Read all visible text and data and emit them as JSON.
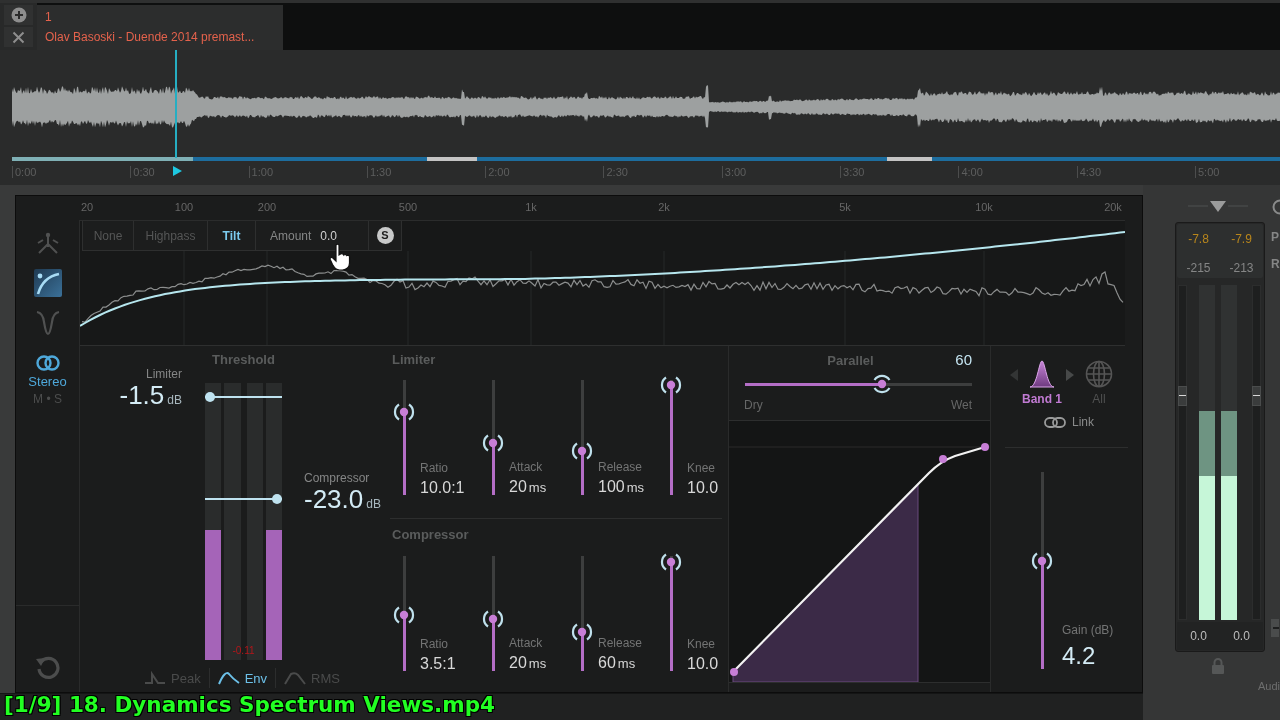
{
  "session_tab": {
    "number": "1",
    "title": "Olav Basoski - Duende 2014 premast..."
  },
  "timeline": {
    "labels": [
      "0:00",
      "0:30",
      "1:00",
      "1:30",
      "2:00",
      "2:30",
      "3:00",
      "3:30",
      "4:00",
      "4:30",
      "5:00"
    ]
  },
  "spectrum": {
    "frequency_labels": [
      "20",
      "100",
      "200",
      "500",
      "1k",
      "2k",
      "5k",
      "10k",
      "20k"
    ],
    "view_tools": [
      {
        "kind": "fan",
        "selected": false
      },
      {
        "kind": "curve",
        "selected": true
      },
      {
        "kind": "notch",
        "selected": false
      }
    ],
    "filter_modes": [
      {
        "label": "None",
        "selected": false
      },
      {
        "label": "Highpass",
        "selected": false
      },
      {
        "label": "Tilt",
        "selected": true
      }
    ],
    "amount": {
      "label": "Amount",
      "value": "0.0"
    },
    "solo_label": "S"
  },
  "channel_modes": [
    {
      "label": "Stereo",
      "selected": true
    },
    {
      "label": "M • S",
      "selected": false
    }
  ],
  "threshold": {
    "title": "Threshold",
    "limiter": {
      "label": "Limiter",
      "value": "-1.5",
      "unit": "dB",
      "level": 0.95
    },
    "compressor": {
      "label": "Compressor",
      "value": "-23.0",
      "unit": "dB",
      "level": 0.58
    },
    "meters": [
      {
        "level": 0.47
      },
      {
        "level": 0.47
      }
    ],
    "reading": "-0.11",
    "detection_modes": [
      {
        "kind": "peak",
        "label": "Peak",
        "selected": false
      },
      {
        "kind": "envelope",
        "label": "Env",
        "selected": true
      },
      {
        "kind": "rms",
        "label": "RMS",
        "selected": false
      }
    ]
  },
  "limiter": {
    "title": "Limiter",
    "controls": [
      {
        "label": "Ratio",
        "value": "10.0:1",
        "level": 0.72
      },
      {
        "label": "Attack",
        "value": "20",
        "unit": "ms",
        "level": 0.45
      },
      {
        "label": "Release",
        "value": "100",
        "unit": "ms",
        "level": 0.38
      },
      {
        "label": "Knee",
        "value": "10.0",
        "level": 0.96
      }
    ]
  },
  "compressor": {
    "title": "Compressor",
    "controls": [
      {
        "label": "Ratio",
        "value": "3.5:1",
        "level": 0.49
      },
      {
        "label": "Attack",
        "value": "20",
        "unit": "ms",
        "level": 0.45
      },
      {
        "label": "Release",
        "value": "60",
        "unit": "ms",
        "level": 0.34
      },
      {
        "label": "Knee",
        "value": "10.0",
        "level": 0.95
      }
    ]
  },
  "parallel": {
    "title": "Parallel",
    "value": "60",
    "level": 0.6,
    "min_label": "Dry",
    "max_label": "Wet"
  },
  "bands": [
    {
      "kind": "band",
      "label": "Band 1",
      "selected": true
    },
    {
      "kind": "all",
      "label": "All",
      "selected": false
    }
  ],
  "link": {
    "label": "Link"
  },
  "gain": {
    "label": "Gain (dB)",
    "value": "4.2",
    "level": 0.55
  },
  "output_meter": {
    "peak_readings": [
      "-7.8",
      "-7.9"
    ],
    "rms_readings": [
      "-215",
      "-213"
    ],
    "faders": [
      {
        "level": 0.67
      },
      {
        "level": 0.67
      }
    ],
    "channels": [
      {
        "level": 0.43,
        "reading": "0.0"
      },
      {
        "level": 0.43,
        "reading": "0.0"
      }
    ]
  },
  "edge": {
    "labels": [
      "P",
      "R"
    ],
    "footer": "Audi"
  },
  "video_title": "[1/9] 18. Dynamics Spectrum Views.mp4"
}
